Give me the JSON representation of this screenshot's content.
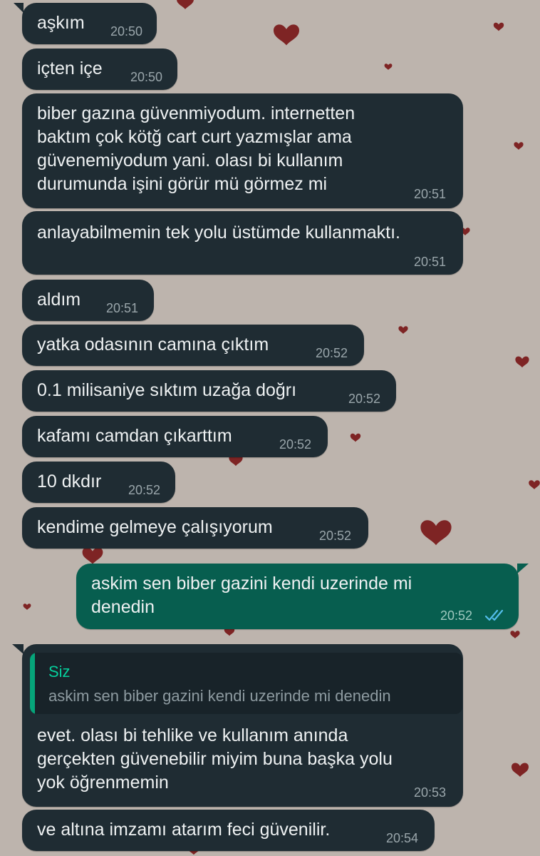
{
  "colors": {
    "wallpaper": "#bdb4ad",
    "incoming_bubble": "#1f2c33",
    "outgoing_bubble": "#075e4f",
    "heart": "#7e2424",
    "read_ticks": "#53bdeb",
    "quote_accent": "#06cf9c"
  },
  "messages": [
    {
      "direction": "in",
      "text": "aşkım",
      "time": "20:50"
    },
    {
      "direction": "in",
      "text": "içten içe",
      "time": "20:50"
    },
    {
      "direction": "in",
      "text": "biber gazına güvenmiyodum. internetten\nbaktım çok kötğ cart curt yazmışlar ama\ngüvenemiyodum yani. olası bi kullanım\ndurumunda işini görür mü görmez mi",
      "time": "20:51"
    },
    {
      "direction": "in",
      "text": "anlayabilmemin tek yolu üstümde kullanmaktı.",
      "time": "20:51"
    },
    {
      "direction": "in",
      "text": "aldım",
      "time": "20:51"
    },
    {
      "direction": "in",
      "text": "yatka odasının camına çıktım",
      "time": "20:52"
    },
    {
      "direction": "in",
      "text": "0.1 milisaniye sıktım uzağa doğrı",
      "time": "20:52"
    },
    {
      "direction": "in",
      "text": "kafamı camdan çıkarttım",
      "time": "20:52"
    },
    {
      "direction": "in",
      "text": "10 dkdır",
      "time": "20:52"
    },
    {
      "direction": "in",
      "text": "kendime gelmeye çalışıyorum",
      "time": "20:52"
    },
    {
      "direction": "out",
      "text": "askim sen biber gazini kendi uzerinde mi\ndenedin",
      "time": "20:52",
      "status": "read",
      "status_icon": "double-check-icon"
    },
    {
      "direction": "in",
      "quote": {
        "author": "Siz",
        "text": "askim sen biber gazini kendi uzerinde mi denedin"
      },
      "text": "evet. olası bi tehlike ve kullanım anında\ngerçekten güvenebilir miyim buna başka yolu\nyok öğrenmemin",
      "time": "20:53"
    },
    {
      "direction": "in",
      "text": "ve altına imzamı atarım feci güvenilir.",
      "time": "20:54"
    }
  ]
}
